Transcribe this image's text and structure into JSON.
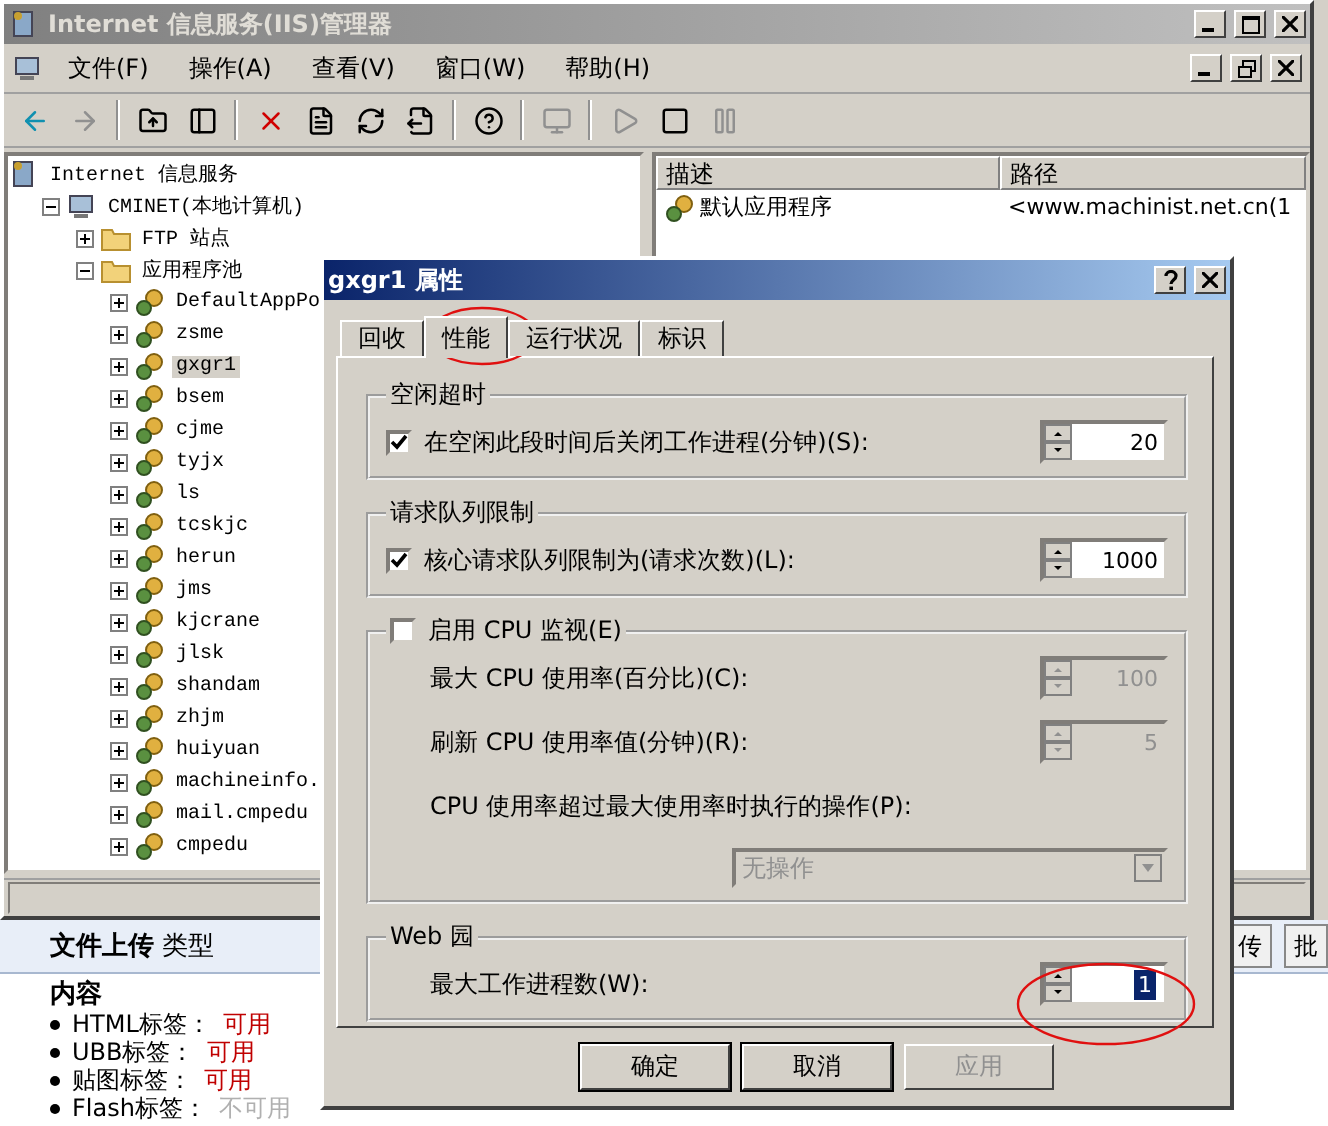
{
  "main_window": {
    "title": "Internet 信息服务(IIS)管理器",
    "menu": [
      "文件(F)",
      "操作(A)",
      "查看(V)",
      "窗口(W)",
      "帮助(H)"
    ],
    "tree": [
      {
        "label": "Internet 信息服务",
        "kind": "root",
        "selected": false,
        "children": [
          {
            "label": "CMINET(本地计算机)",
            "kind": "computer",
            "expanded": true,
            "selected": false,
            "children": [
              {
                "label": "FTP 站点",
                "kind": "folder",
                "expanded": false,
                "selected": false
              },
              {
                "label": "应用程序池",
                "kind": "folder",
                "expanded": true,
                "selected": false,
                "children": [
                  {
                    "label": "DefaultAppPo",
                    "kind": "pool",
                    "expanded": false,
                    "selected": false
                  },
                  {
                    "label": "zsme",
                    "kind": "pool",
                    "expanded": false,
                    "selected": false
                  },
                  {
                    "label": "gxgr1",
                    "kind": "pool",
                    "expanded": false,
                    "selected": true
                  },
                  {
                    "label": "bsem",
                    "kind": "pool",
                    "expanded": false,
                    "selected": false
                  },
                  {
                    "label": "cjme",
                    "kind": "pool",
                    "expanded": false,
                    "selected": false
                  },
                  {
                    "label": "tyjx",
                    "kind": "pool",
                    "expanded": false,
                    "selected": false
                  },
                  {
                    "label": "ls",
                    "kind": "pool",
                    "expanded": false,
                    "selected": false
                  },
                  {
                    "label": "tcskjc",
                    "kind": "pool",
                    "expanded": false,
                    "selected": false
                  },
                  {
                    "label": "herun",
                    "kind": "pool",
                    "expanded": false,
                    "selected": false
                  },
                  {
                    "label": "jms",
                    "kind": "pool",
                    "expanded": false,
                    "selected": false
                  },
                  {
                    "label": "kjcrane",
                    "kind": "pool",
                    "expanded": false,
                    "selected": false
                  },
                  {
                    "label": "jlsk",
                    "kind": "pool",
                    "expanded": false,
                    "selected": false
                  },
                  {
                    "label": "shandam",
                    "kind": "pool",
                    "expanded": false,
                    "selected": false
                  },
                  {
                    "label": "zhjm",
                    "kind": "pool",
                    "expanded": false,
                    "selected": false
                  },
                  {
                    "label": "huiyuan",
                    "kind": "pool",
                    "expanded": false,
                    "selected": false
                  },
                  {
                    "label": "machineinfo.",
                    "kind": "pool",
                    "expanded": false,
                    "selected": false
                  },
                  {
                    "label": "mail.cmpedu",
                    "kind": "pool",
                    "expanded": false,
                    "selected": false
                  },
                  {
                    "label": "cmpedu",
                    "kind": "pool",
                    "expanded": false,
                    "selected": false
                  }
                ]
              }
            ]
          }
        ]
      }
    ],
    "list": {
      "columns": [
        "描述",
        "路径"
      ],
      "rows": [
        [
          "默认应用程序",
          "<www.machinist.net.cn(1"
        ]
      ]
    }
  },
  "background_page": {
    "header": "**文件上传** 类型",
    "side_buttons": [
      "传",
      "批"
    ],
    "content_title": "内容",
    "items": [
      {
        "label": "HTML标签：",
        "status": "可用",
        "available": true
      },
      {
        "label": "UBB标签：",
        "status": "可用",
        "available": true
      },
      {
        "label": "贴图标签：",
        "status": "可用",
        "available": true
      },
      {
        "label": "Flash标签：",
        "status": "不可用",
        "available": false
      }
    ]
  },
  "dialog": {
    "title": "gxgr1 属性",
    "tabs": [
      {
        "label": "回收",
        "selected": false
      },
      {
        "label": "性能",
        "selected": true
      },
      {
        "label": "运行状况",
        "selected": false
      },
      {
        "label": "标识",
        "selected": false
      }
    ],
    "sections": [
      {
        "title": "空闲超时",
        "rows": [
          {
            "kind": "spin",
            "label": "在空闲此段时间后关闭工作进程(分钟)(S):",
            "checked": true,
            "value": "20",
            "disabled": false
          }
        ]
      },
      {
        "title": "请求队列限制",
        "rows": [
          {
            "kind": "spin",
            "label": "核心请求队列限制为(请求次数)(L):",
            "checked": true,
            "value": "1000",
            "disabled": false
          }
        ]
      },
      {
        "title": "启用 CPU 监视(E)",
        "checked": false,
        "rows": [
          {
            "kind": "spin",
            "label": "最大 CPU 使用率(百分比)(C):",
            "value": "100",
            "disabled": true
          },
          {
            "kind": "spin",
            "label": "刷新 CPU 使用率值(分钟)(R):",
            "value": "5",
            "disabled": true
          },
          {
            "kind": "text",
            "label": "CPU 使用率超过最大使用率时执行的操作(P):"
          },
          {
            "kind": "select",
            "value": "无操作",
            "disabled": true
          }
        ]
      },
      {
        "title": "Web 园",
        "rows": [
          {
            "kind": "spin",
            "label": "最大工作进程数(W):",
            "value": "1",
            "disabled": false,
            "value_selected": true
          }
        ]
      }
    ],
    "buttons": [
      {
        "label": "确定",
        "disabled": false
      },
      {
        "label": "取消",
        "disabled": false
      },
      {
        "label": "应用",
        "disabled": true
      }
    ]
  }
}
